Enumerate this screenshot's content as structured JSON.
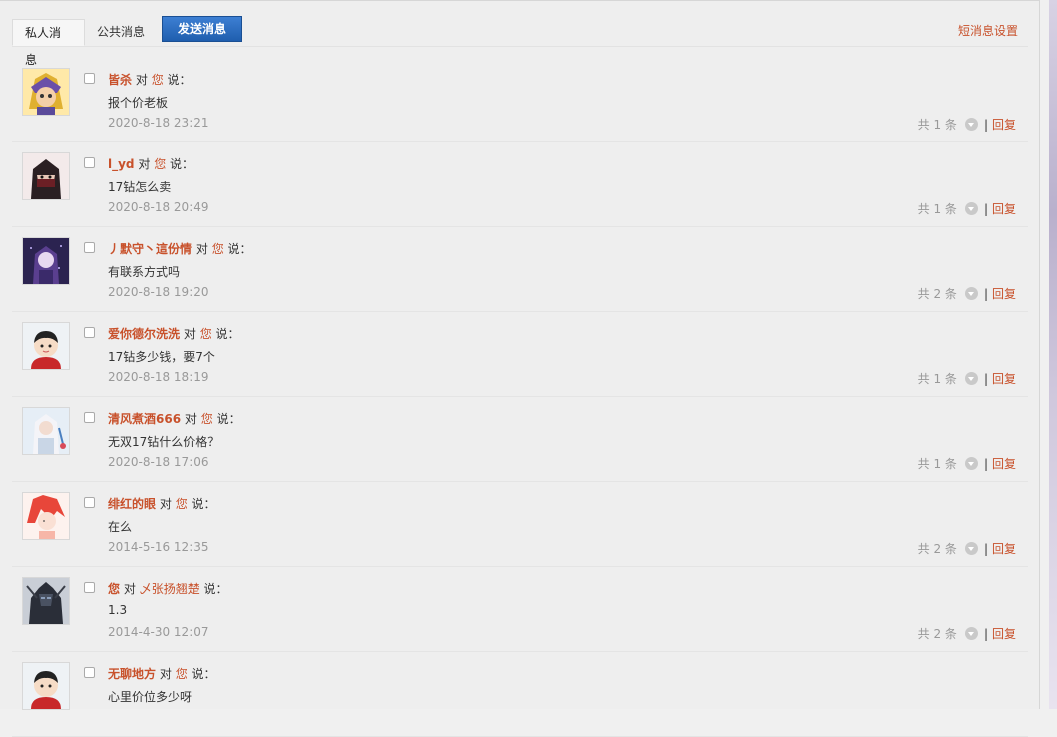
{
  "tabs": [
    {
      "label": "私人消息",
      "active": true
    },
    {
      "label": "公共消息",
      "active": false
    }
  ],
  "send_button": "发送消息",
  "settings_link": "短消息设置",
  "connector": "对",
  "says": "说：",
  "reply_label": "回复",
  "messages": [
    {
      "sender": "皆杀",
      "recipient": "您",
      "text": "报个价老板",
      "date": "2020-8-18 23:21",
      "count": "共 1 条",
      "avatar": "cartoon-hero-avatar"
    },
    {
      "sender": "l_yd",
      "recipient": "您",
      "text": "17钻怎么卖",
      "date": "2020-8-18 20:49",
      "count": "共 1 条",
      "avatar": "masked-warrior-avatar"
    },
    {
      "sender": "丿默守丶這份情",
      "recipient": "您",
      "text": "有联系方式吗",
      "date": "2020-8-18 19:20",
      "count": "共 2 条",
      "avatar": "dark-anime-girl-avatar"
    },
    {
      "sender": "爱你德尔洗洗",
      "recipient": "您",
      "text": "17钻多少钱，要7个",
      "date": "2020-8-18 18:19",
      "count": "共 1 条",
      "avatar": "default-boy-avatar"
    },
    {
      "sender": "清风煮酒666",
      "recipient": "您",
      "text": "无双17钻什么价格？",
      "date": "2020-8-18 17:06",
      "count": "共 1 条",
      "avatar": "white-haired-swordsman-avatar"
    },
    {
      "sender": "绯红的眼",
      "recipient": "您",
      "text": "在么",
      "date": "2014-5-16 12:35",
      "count": "共 2 条",
      "avatar": "red-haired-anime-avatar"
    },
    {
      "sender": "您",
      "recipient": "乄张扬翘楚",
      "text": "1.3",
      "date": "2014-4-30 12:07",
      "count": "共 2 条",
      "avatar": "dark-knight-avatar"
    },
    {
      "sender": "无聊地方",
      "recipient": "您",
      "text": "心里价位多少呀",
      "date": "",
      "count": "",
      "avatar": "default-boy-avatar"
    }
  ]
}
